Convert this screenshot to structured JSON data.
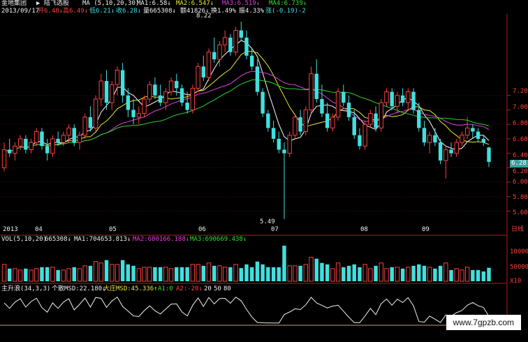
{
  "header": {
    "app_title": "金地集团",
    "stock_name": "▶ 陆飞选股",
    "ma_title": "MA (5,10,20,30)",
    "ma1": "MA1:6.58↓",
    "ma2": "MA2:6.547↓",
    "ma3": "MA3:6.519↓",
    "ma4": "MA4:6.739↓",
    "date": "2013/09/17",
    "open": "开6.48↓",
    "high": "高6.49↓",
    "low": "低6.21↓",
    "close": "收6.28↓",
    "volume": "量665308↓",
    "amount": "额41826↓",
    "turnover": "换1.49%",
    "amplitude": "振4.33%",
    "change": "涨(-0.19)-2"
  },
  "price_axis": [
    "7.20",
    "7.00",
    "6.80",
    "6.60",
    "6.40",
    "6.20",
    "6.00",
    "5.80",
    "5.60"
  ],
  "current_price": "6.28",
  "high_marker": "8.22",
  "low_marker": "5.49",
  "time_axis": {
    "year": "2013",
    "months": [
      "04",
      "05",
      "06",
      "07",
      "08",
      "09"
    ],
    "period": "日线"
  },
  "vol_panel": {
    "title": "VOL(5,10,20)",
    "value": "665308↓",
    "ma1": "MA1:704653.813↓",
    "ma2": "MA2:680166.188↓",
    "ma3": "MA3:690669.438↓",
    "axis": [
      "1000000",
      "500000"
    ],
    "unit": "X10"
  },
  "ind_panel": {
    "title": "主升浪(34,3,3)",
    "retail": "个散MSD:22.180↓",
    "whale": "大庄MSD:45.336↑",
    "a1": "A1:0",
    "a2": "A2:-20↓",
    "l20": "20",
    "l50": "50",
    "l80": "80"
  },
  "watermark": "www.7gpzb.com",
  "colors": {
    "up": "#ff4040",
    "down": "#40e0e0",
    "ma1": "#ffffff",
    "ma2": "#e8e830",
    "ma3": "#e040e0",
    "ma4": "#30d030"
  },
  "chart_data": {
    "type": "candlestick",
    "price_range": [
      5.45,
      8.25
    ],
    "candles": [
      {
        "o": 6.2,
        "h": 6.55,
        "l": 6.15,
        "c": 6.45
      },
      {
        "o": 6.45,
        "h": 6.6,
        "l": 6.35,
        "c": 6.4
      },
      {
        "o": 6.4,
        "h": 6.55,
        "l": 6.3,
        "c": 6.5
      },
      {
        "o": 6.5,
        "h": 6.65,
        "l": 6.45,
        "c": 6.6
      },
      {
        "o": 6.6,
        "h": 6.65,
        "l": 6.4,
        "c": 6.45
      },
      {
        "o": 6.45,
        "h": 6.6,
        "l": 6.4,
        "c": 6.55
      },
      {
        "o": 6.55,
        "h": 6.75,
        "l": 6.5,
        "c": 6.7
      },
      {
        "o": 6.7,
        "h": 6.75,
        "l": 6.45,
        "c": 6.5
      },
      {
        "o": 6.5,
        "h": 6.6,
        "l": 6.3,
        "c": 6.4
      },
      {
        "o": 6.4,
        "h": 6.65,
        "l": 6.35,
        "c": 6.6
      },
      {
        "o": 6.6,
        "h": 6.7,
        "l": 6.5,
        "c": 6.55
      },
      {
        "o": 6.55,
        "h": 6.7,
        "l": 6.5,
        "c": 6.65
      },
      {
        "o": 6.65,
        "h": 6.8,
        "l": 6.55,
        "c": 6.75
      },
      {
        "o": 6.75,
        "h": 6.8,
        "l": 6.5,
        "c": 6.55
      },
      {
        "o": 6.55,
        "h": 6.7,
        "l": 6.45,
        "c": 6.65
      },
      {
        "o": 6.65,
        "h": 6.95,
        "l": 6.6,
        "c": 6.9
      },
      {
        "o": 6.9,
        "h": 7.05,
        "l": 6.7,
        "c": 6.75
      },
      {
        "o": 6.75,
        "h": 7.2,
        "l": 6.7,
        "c": 7.15
      },
      {
        "o": 7.15,
        "h": 7.5,
        "l": 7.05,
        "c": 7.4
      },
      {
        "o": 7.4,
        "h": 7.55,
        "l": 7.0,
        "c": 7.1
      },
      {
        "o": 7.1,
        "h": 7.4,
        "l": 7.0,
        "c": 7.35
      },
      {
        "o": 7.35,
        "h": 7.6,
        "l": 7.2,
        "c": 7.55
      },
      {
        "o": 7.55,
        "h": 7.65,
        "l": 7.1,
        "c": 7.2
      },
      {
        "o": 7.2,
        "h": 7.3,
        "l": 6.9,
        "c": 7.0
      },
      {
        "o": 7.0,
        "h": 7.15,
        "l": 6.8,
        "c": 6.9
      },
      {
        "o": 6.9,
        "h": 7.05,
        "l": 6.8,
        "c": 6.95
      },
      {
        "o": 6.95,
        "h": 7.2,
        "l": 6.9,
        "c": 7.15
      },
      {
        "o": 7.15,
        "h": 7.4,
        "l": 7.1,
        "c": 7.35
      },
      {
        "o": 7.35,
        "h": 7.45,
        "l": 7.15,
        "c": 7.2
      },
      {
        "o": 7.2,
        "h": 7.35,
        "l": 7.05,
        "c": 7.1
      },
      {
        "o": 7.1,
        "h": 7.3,
        "l": 7.0,
        "c": 7.25
      },
      {
        "o": 7.25,
        "h": 7.45,
        "l": 7.2,
        "c": 7.4
      },
      {
        "o": 7.4,
        "h": 7.5,
        "l": 7.2,
        "c": 7.3
      },
      {
        "o": 7.3,
        "h": 7.35,
        "l": 7.05,
        "c": 7.1
      },
      {
        "o": 7.1,
        "h": 7.25,
        "l": 6.95,
        "c": 7.0
      },
      {
        "o": 7.0,
        "h": 7.35,
        "l": 6.95,
        "c": 7.3
      },
      {
        "o": 7.3,
        "h": 7.65,
        "l": 7.25,
        "c": 7.6
      },
      {
        "o": 7.6,
        "h": 7.75,
        "l": 7.4,
        "c": 7.45
      },
      {
        "o": 7.45,
        "h": 7.85,
        "l": 7.4,
        "c": 7.8
      },
      {
        "o": 7.8,
        "h": 8.0,
        "l": 7.65,
        "c": 7.7
      },
      {
        "o": 7.7,
        "h": 7.95,
        "l": 7.6,
        "c": 7.9
      },
      {
        "o": 7.9,
        "h": 8.1,
        "l": 7.8,
        "c": 8.0
      },
      {
        "o": 8.0,
        "h": 8.05,
        "l": 7.75,
        "c": 7.8
      },
      {
        "o": 7.8,
        "h": 8.15,
        "l": 7.75,
        "c": 8.1
      },
      {
        "o": 8.1,
        "h": 8.22,
        "l": 7.95,
        "c": 8.0
      },
      {
        "o": 8.0,
        "h": 8.1,
        "l": 7.7,
        "c": 7.75
      },
      {
        "o": 7.75,
        "h": 7.85,
        "l": 7.55,
        "c": 7.6
      },
      {
        "o": 7.6,
        "h": 7.7,
        "l": 7.2,
        "c": 7.25
      },
      {
        "o": 7.25,
        "h": 7.3,
        "l": 6.9,
        "c": 6.95
      },
      {
        "o": 6.95,
        "h": 7.0,
        "l": 6.7,
        "c": 6.75
      },
      {
        "o": 6.75,
        "h": 6.85,
        "l": 6.55,
        "c": 6.6
      },
      {
        "o": 6.6,
        "h": 6.7,
        "l": 6.4,
        "c": 6.45
      },
      {
        "o": 6.45,
        "h": 6.55,
        "l": 5.49,
        "c": 6.4
      },
      {
        "o": 6.4,
        "h": 6.7,
        "l": 6.35,
        "c": 6.65
      },
      {
        "o": 6.65,
        "h": 6.95,
        "l": 6.6,
        "c": 6.9
      },
      {
        "o": 6.9,
        "h": 7.0,
        "l": 6.65,
        "c": 6.7
      },
      {
        "o": 6.7,
        "h": 7.05,
        "l": 6.65,
        "c": 7.0
      },
      {
        "o": 7.0,
        "h": 7.6,
        "l": 6.95,
        "c": 7.5
      },
      {
        "o": 7.5,
        "h": 7.7,
        "l": 7.1,
        "c": 7.15
      },
      {
        "o": 7.15,
        "h": 7.35,
        "l": 6.9,
        "c": 6.95
      },
      {
        "o": 6.95,
        "h": 7.1,
        "l": 6.7,
        "c": 6.75
      },
      {
        "o": 6.75,
        "h": 6.95,
        "l": 6.7,
        "c": 6.9
      },
      {
        "o": 6.9,
        "h": 7.3,
        "l": 6.85,
        "c": 7.25
      },
      {
        "o": 7.25,
        "h": 7.35,
        "l": 7.05,
        "c": 7.1
      },
      {
        "o": 7.1,
        "h": 7.2,
        "l": 6.85,
        "c": 6.9
      },
      {
        "o": 6.9,
        "h": 7.0,
        "l": 6.6,
        "c": 6.65
      },
      {
        "o": 6.65,
        "h": 6.75,
        "l": 6.45,
        "c": 6.5
      },
      {
        "o": 6.5,
        "h": 6.85,
        "l": 6.45,
        "c": 6.8
      },
      {
        "o": 6.8,
        "h": 7.0,
        "l": 6.75,
        "c": 6.95
      },
      {
        "o": 6.95,
        "h": 7.05,
        "l": 6.7,
        "c": 6.75
      },
      {
        "o": 6.75,
        "h": 7.15,
        "l": 6.7,
        "c": 7.1
      },
      {
        "o": 7.1,
        "h": 7.3,
        "l": 7.05,
        "c": 7.25
      },
      {
        "o": 7.25,
        "h": 7.3,
        "l": 7.0,
        "c": 7.05
      },
      {
        "o": 7.05,
        "h": 7.25,
        "l": 6.95,
        "c": 7.2
      },
      {
        "o": 7.2,
        "h": 7.3,
        "l": 7.05,
        "c": 7.1
      },
      {
        "o": 7.1,
        "h": 7.3,
        "l": 7.0,
        "c": 7.25
      },
      {
        "o": 7.25,
        "h": 7.3,
        "l": 6.95,
        "c": 7.0
      },
      {
        "o": 7.0,
        "h": 7.1,
        "l": 6.7,
        "c": 6.75
      },
      {
        "o": 6.75,
        "h": 6.85,
        "l": 6.5,
        "c": 6.55
      },
      {
        "o": 6.55,
        "h": 6.7,
        "l": 6.4,
        "c": 6.65
      },
      {
        "o": 6.65,
        "h": 6.75,
        "l": 6.5,
        "c": 6.55
      },
      {
        "o": 6.55,
        "h": 6.6,
        "l": 6.25,
        "c": 6.3
      },
      {
        "o": 6.3,
        "h": 6.5,
        "l": 6.05,
        "c": 6.45
      },
      {
        "o": 6.45,
        "h": 6.55,
        "l": 6.35,
        "c": 6.4
      },
      {
        "o": 6.4,
        "h": 6.6,
        "l": 6.35,
        "c": 6.55
      },
      {
        "o": 6.55,
        "h": 6.7,
        "l": 6.5,
        "c": 6.65
      },
      {
        "o": 6.65,
        "h": 6.9,
        "l": 6.6,
        "c": 6.75
      },
      {
        "o": 6.75,
        "h": 6.8,
        "l": 6.6,
        "c": 6.7
      },
      {
        "o": 6.7,
        "h": 6.75,
        "l": 6.55,
        "c": 6.6
      },
      {
        "o": 6.6,
        "h": 6.65,
        "l": 6.5,
        "c": 6.55
      },
      {
        "o": 6.48,
        "h": 6.49,
        "l": 6.21,
        "c": 6.28
      }
    ],
    "volume_ma_note": "",
    "indicator_levels": [
      20,
      50,
      80
    ]
  }
}
